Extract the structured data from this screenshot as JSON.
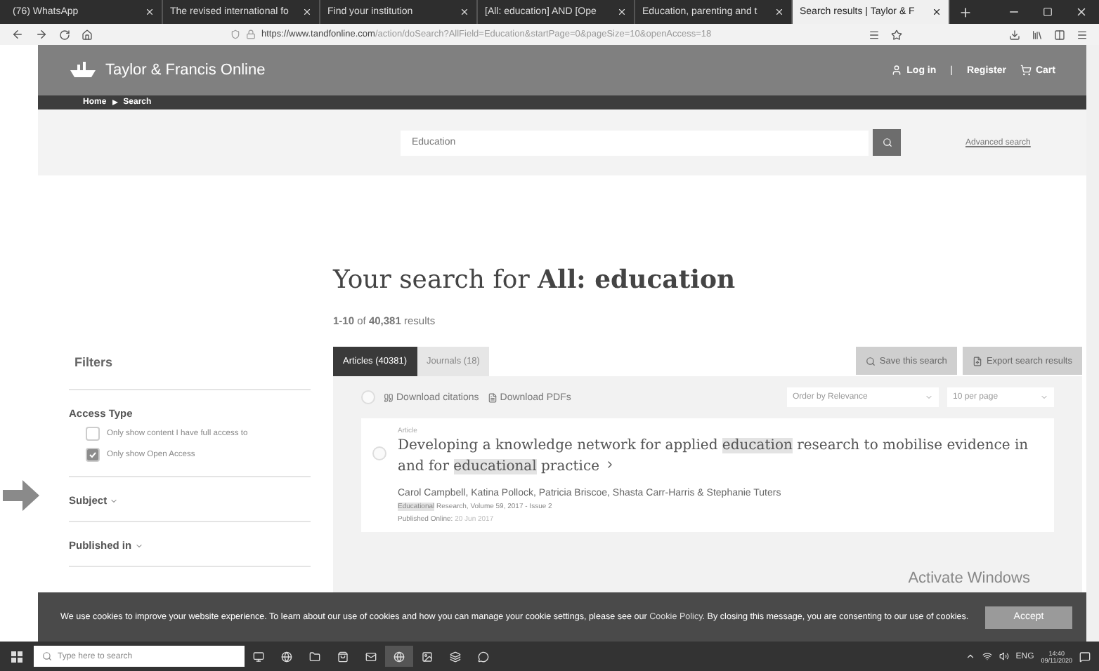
{
  "browser": {
    "tabs": [
      {
        "title": "(76) WhatsApp",
        "selected": false
      },
      {
        "title": "The revised international fo",
        "selected": false
      },
      {
        "title": "Find your institution",
        "selected": false
      },
      {
        "title": "[All: education] AND [Ope",
        "selected": false
      },
      {
        "title": "Education, parenting and t",
        "selected": false
      },
      {
        "title": "Search results | Taylor & F",
        "selected": true
      }
    ],
    "url_host": "https://www.tandfonline.com",
    "url_path": "/action/doSearch?AllField=Education&startPage=0&pageSize=10&openAccess=18"
  },
  "site": {
    "logo": "Taylor & Francis Online",
    "nav": [
      "Log in",
      "Register",
      "Cart"
    ],
    "nav_separator": "|",
    "breadcrumb": [
      "Home",
      "Search"
    ],
    "search": {
      "value": "Education"
    },
    "advanced_search": "Advanced search"
  },
  "heading": "Your search for **All: education**",
  "count": "**1-10** of **40,381** results",
  "filters": {
    "title": "Filters",
    "groups": [
      {
        "title": "Access Type",
        "expandable": false,
        "options": [
          {
            "label": "Only show content I have full access to",
            "checked": false
          },
          {
            "label": "Only show Open Access",
            "checked": true
          }
        ]
      },
      {
        "title": "Subject",
        "expandable": true
      },
      {
        "title": "Published in",
        "expandable": true
      }
    ]
  },
  "result_tabs": [
    {
      "label": "Articles (40381)",
      "selected": true
    },
    {
      "label": "Journals (18)",
      "selected": false
    }
  ],
  "actions": [
    {
      "label": "Save this search",
      "kind": "search"
    },
    {
      "label": "Export search results",
      "kind": "export"
    }
  ],
  "toolbar": {
    "select_all_checked": false,
    "download_citations": "Download citations",
    "download_pdfs": "Download PDFs",
    "sort": "Order by Relevance",
    "per_page": "10 per page"
  },
  "results": [
    {
      "checked": false,
      "type": "Article",
      "title": [
        {
          "text": "Developing a knowledge network for applied ",
          "highlight": false
        },
        {
          "text": "education",
          "highlight": true
        },
        {
          "text": " research to mobilise evidence in and for ",
          "highlight": false
        },
        {
          "text": "educational",
          "highlight": true
        },
        {
          "text": " practice",
          "highlight": false
        }
      ],
      "authors": "Carol Campbell, Katina Pollock, Patricia Briscoe, Shasta Carr-Harris & Stephanie Tuters",
      "journal": [
        {
          "text": "Educational",
          "highlight": true
        },
        {
          "text": " Research, Volume 59, 2017 - Issue 2",
          "highlight": false
        }
      ],
      "published_label": "Published Online:",
      "published_date": "20 Jun 2017"
    }
  ],
  "os_notice": "Activate Windows",
  "cookie": {
    "text": "We use cookies to improve your website experience. To learn about our use of cookies and how you can manage your cookie settings, please see our",
    "link": "Cookie Policy",
    "after": ". By closing this message, you are consenting to our use of cookies.",
    "button": "Accept"
  },
  "taskbar": {
    "search_placeholder": "Type here to search",
    "lang": "ENG",
    "time": "14:40",
    "date": "09/11/2020"
  }
}
